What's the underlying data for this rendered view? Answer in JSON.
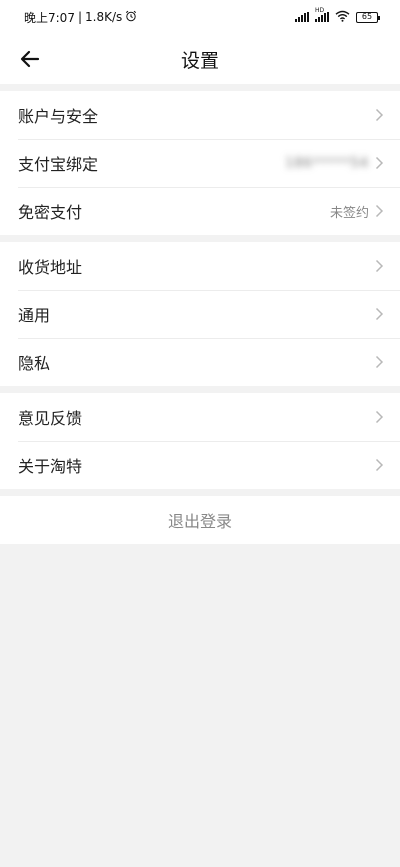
{
  "status_bar": {
    "time": "晚上7:07",
    "speed": "1.8K/s",
    "battery": "65",
    "network_label": "HD"
  },
  "header": {
    "title": "设置"
  },
  "sections": [
    {
      "rows": [
        {
          "label": "账户与安全",
          "value": ""
        },
        {
          "label": "支付宝绑定",
          "value": "186*****54"
        },
        {
          "label": "免密支付",
          "value": "未签约"
        }
      ]
    },
    {
      "rows": [
        {
          "label": "收货地址",
          "value": ""
        },
        {
          "label": "通用",
          "value": ""
        },
        {
          "label": "隐私",
          "value": ""
        }
      ]
    },
    {
      "rows": [
        {
          "label": "意见反馈",
          "value": ""
        },
        {
          "label": "关于淘特",
          "value": ""
        }
      ]
    }
  ],
  "logout_label": "退出登录",
  "colors": {
    "background": "#f2f2f2",
    "chevron": "#b8b8b8",
    "secondary_text": "#888888"
  }
}
